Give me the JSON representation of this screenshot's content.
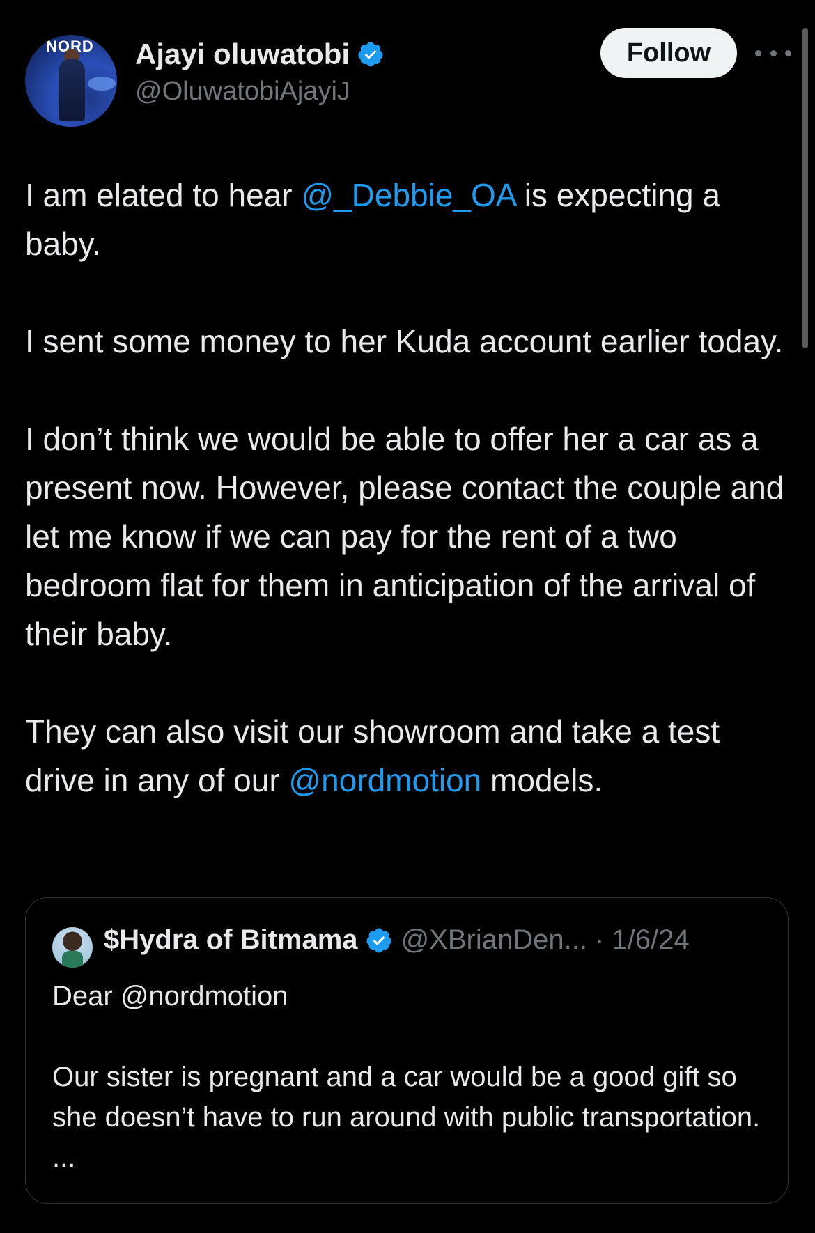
{
  "author": {
    "display_name": "Ajayi oluwatobi",
    "handle": "@OluwatobiAjayiJ",
    "avatar_logo": "NORD",
    "verified": true
  },
  "actions": {
    "follow_label": "Follow",
    "more_icon": "more-horizontal-icon"
  },
  "post": {
    "p1_before": "I am elated to hear ",
    "p1_mention": "@_Debbie_OA",
    "p1_after": " is expecting a baby.",
    "p2": "I sent some money to her Kuda account earlier today.",
    "p3": "I don’t think we would be able to offer her a car as a present now. However, please contact the couple and let me know if we can pay for the rent of a two bedroom flat for them in anticipation of the arrival of their baby.",
    "p4_before": "They can also visit our showroom and take a test drive in any of our ",
    "p4_mention": "@nordmotion",
    "p4_after": " models."
  },
  "quoted_post": {
    "display_name": "$Hydra of Bitmama",
    "handle_date": "@XBrianDen... · 1/6/24",
    "line1": "Dear @nordmotion",
    "line2": "Our sister is pregnant and a car would be a good gift so she doesn’t have to run around with public transportation. ..."
  },
  "colors": {
    "background": "#000000",
    "text": "#e7e9ea",
    "secondary": "#71767b",
    "link": "#1d9bf0",
    "verified": "#1d9bf0"
  }
}
